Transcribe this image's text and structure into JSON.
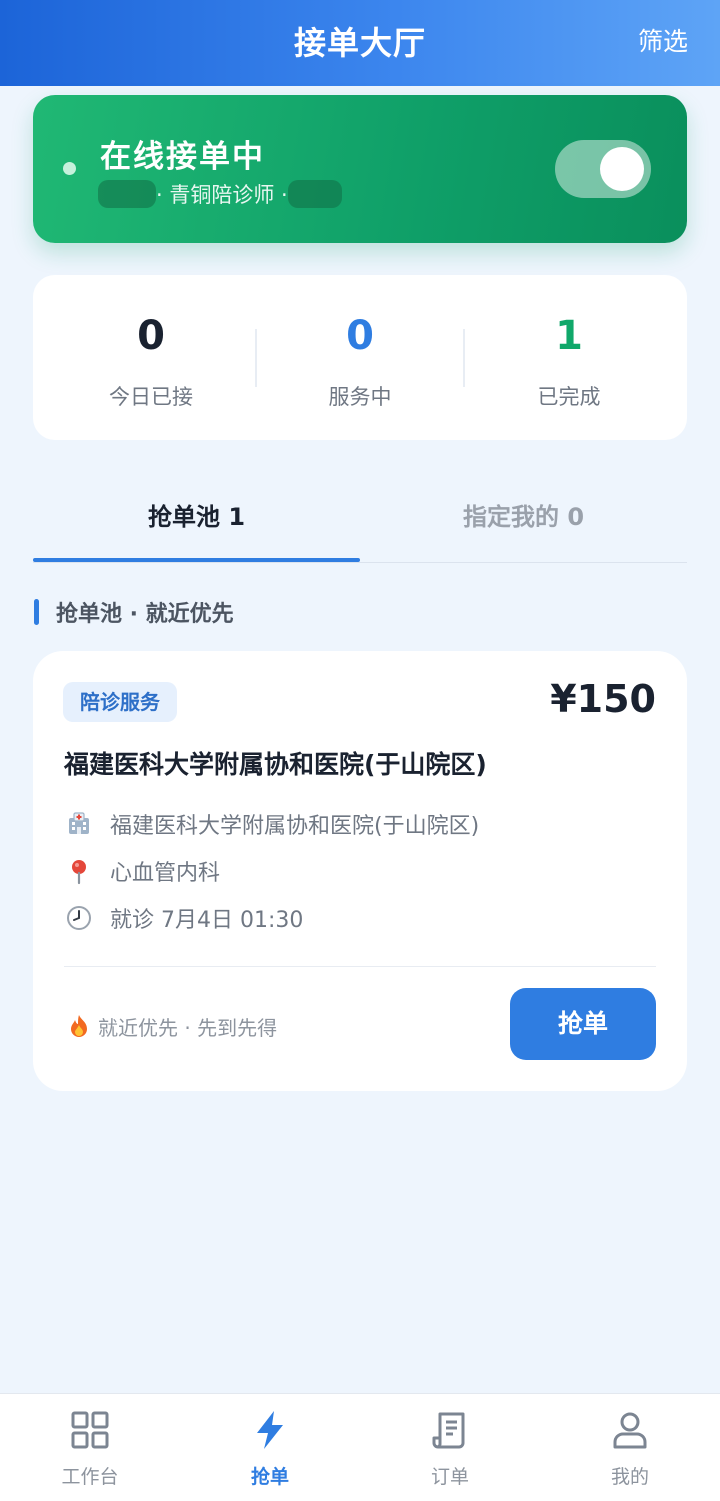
{
  "header": {
    "title": "接单大厅",
    "filter_label": "筛选"
  },
  "online": {
    "title": "在线接单中",
    "level": "· 青铜陪诊师 ·",
    "toggle_on": true
  },
  "stats": [
    {
      "value": "0",
      "label": "今日已接",
      "color": "#1a2230"
    },
    {
      "value": "0",
      "label": "服务中",
      "color": "#2f7de1"
    },
    {
      "value": "1",
      "label": "已完成",
      "color": "#10a86a"
    }
  ],
  "tabs": [
    {
      "label": "抢单池 1",
      "active": true
    },
    {
      "label": "指定我的 0",
      "active": false
    }
  ],
  "section": {
    "title": "抢单池 · 就近优先"
  },
  "order": {
    "tag": "陪诊服务",
    "price": "¥150",
    "hospital_title": "福建医科大学附属协和医院(于山院区)",
    "rows": [
      {
        "icon": "hospital-icon",
        "text": "福建医科大学附属协和医院(于山院区)"
      },
      {
        "icon": "pin-icon",
        "text": "心血管内科"
      },
      {
        "icon": "clock-icon",
        "text": "就诊 7月4日 01:30"
      }
    ],
    "hint": "就近优先 · 先到先得",
    "grab_label": "抢单"
  },
  "nav": [
    {
      "label": "工作台",
      "icon": "grid-icon",
      "active": false
    },
    {
      "label": "抢单",
      "icon": "lightning-icon",
      "active": true
    },
    {
      "label": "订单",
      "icon": "receipt-icon",
      "active": false
    },
    {
      "label": "我的",
      "icon": "user-icon",
      "active": false
    }
  ],
  "colors": {
    "accent": "#2f7de1",
    "online_green": "#10a86a",
    "background": "#eef5fd"
  }
}
